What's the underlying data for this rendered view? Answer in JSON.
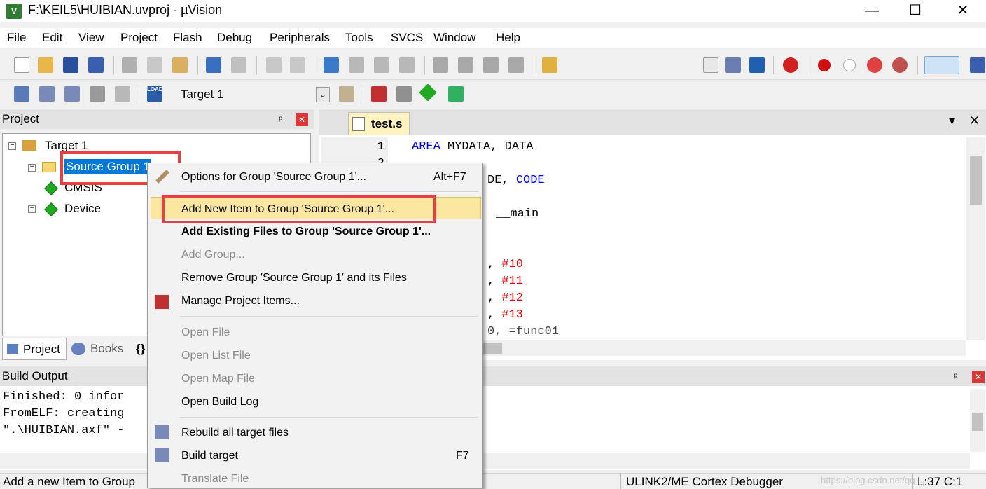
{
  "window": {
    "title": "F:\\KEIL5\\HUIBIAN.uvproj - µVision",
    "app_icon_letter": "V",
    "minimize": "—",
    "maximize": "☐",
    "close": "✕"
  },
  "menubar": {
    "items": [
      "File",
      "Edit",
      "View",
      "Project",
      "Flash",
      "Debug",
      "Peripherals",
      "Tools",
      "SVCS",
      "Window",
      "Help"
    ]
  },
  "build_toolbar": {
    "target_select": "Target 1",
    "load_label": "LOAD"
  },
  "project_pane": {
    "title": "Project",
    "pin": "ᵖ",
    "close": "✕",
    "tree": {
      "root": "Target 1",
      "children": [
        "Source Group 1",
        "CMSIS",
        "Device"
      ]
    },
    "bottom_tabs": [
      "Project",
      "Books",
      "{}"
    ]
  },
  "editor": {
    "tab_label": "test.s",
    "tab_dropdown": "▾",
    "tab_close": "✕",
    "line_numbers": [
      "1",
      "2"
    ],
    "lines": [
      {
        "kw": "AREA",
        "rest": " MYDATA, DATA"
      },
      {
        "pre": "DE, ",
        "kw": "CODE"
      },
      {
        "rest": "__main"
      },
      {
        "pre": ", ",
        "num": "#10"
      },
      {
        "pre": ", ",
        "num": "#11"
      },
      {
        "pre": ", ",
        "num": "#12"
      },
      {
        "pre": ", ",
        "num": "#13"
      },
      {
        "rest": "0, =func01"
      }
    ]
  },
  "build_output": {
    "title": "Build Output",
    "lines": [
      "Finished: 0 infor",
      "FromELF: creating",
      "\".\\HUIBIAN.axf\" -"
    ]
  },
  "context_menu": {
    "items": [
      {
        "label": "Options for Group 'Source Group 1'...",
        "shortcut": "Alt+F7",
        "state": "normal",
        "icon": "wand-icon"
      },
      {
        "label": "Add New  Item to Group 'Source Group 1'...",
        "shortcut": "",
        "state": "highlighted"
      },
      {
        "label": "Add Existing Files to Group 'Source Group 1'...",
        "shortcut": "",
        "state": "bold"
      },
      {
        "label": "Add Group...",
        "shortcut": "",
        "state": "disabled"
      },
      {
        "label": "Remove Group 'Source Group 1' and its Files",
        "shortcut": "",
        "state": "normal"
      },
      {
        "label": "Manage Project Items...",
        "shortcut": "",
        "state": "normal",
        "icon": "manage-items-icon"
      },
      {
        "label": "Open File",
        "shortcut": "",
        "state": "disabled"
      },
      {
        "label": "Open List File",
        "shortcut": "",
        "state": "disabled"
      },
      {
        "label": "Open Map File",
        "shortcut": "",
        "state": "disabled"
      },
      {
        "label": "Open Build Log",
        "shortcut": "",
        "state": "normal"
      },
      {
        "label": "Rebuild all target files",
        "shortcut": "",
        "state": "normal",
        "icon": "rebuild-icon"
      },
      {
        "label": "Build target",
        "shortcut": "F7",
        "state": "normal",
        "icon": "build-icon"
      },
      {
        "label": "Translate File",
        "shortcut": "",
        "state": "disabled"
      }
    ]
  },
  "statusbar": {
    "hint": "Add a new Item to Group",
    "debugger": "ULINK2/ME Cortex Debugger",
    "position": "L:37 C:1",
    "watermark": "https://blog.csdn.net/qq_..."
  },
  "colors": {
    "highlight_box": "#e84040",
    "selection": "#0078d7",
    "menu_hover": "#fce7a0",
    "keyword": "#0000ff",
    "number": "#e00000"
  }
}
